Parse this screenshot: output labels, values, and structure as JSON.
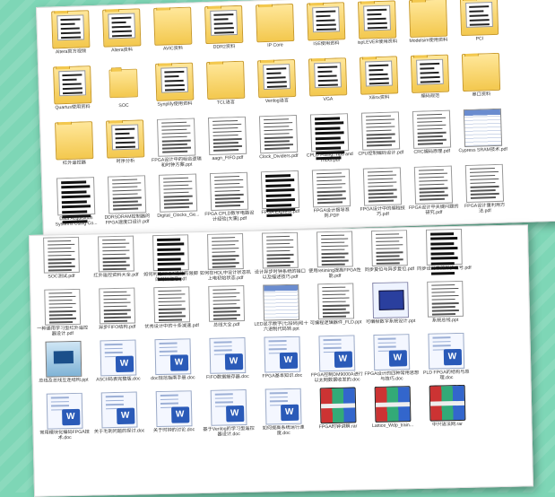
{
  "window1": {
    "items": [
      {
        "label": "Altera官方视频",
        "type": "folder"
      },
      {
        "label": "Altera资料",
        "type": "folder"
      },
      {
        "label": "AVIC资料",
        "type": "folder-empty"
      },
      {
        "label": "DDR2资料",
        "type": "folder"
      },
      {
        "label": "IP Core",
        "type": "folder-empty"
      },
      {
        "label": "ISE使用资料",
        "type": "folder"
      },
      {
        "label": "ispLEVER使用资料",
        "type": "folder"
      },
      {
        "label": "Modelsim使用资料",
        "type": "folder-empty"
      },
      {
        "label": "PCI",
        "type": "folder"
      },
      {
        "label": "",
        "type": "none"
      },
      {
        "label": "Quartus使用资料",
        "type": "folder"
      },
      {
        "label": "SOC",
        "type": "folder-empty-small"
      },
      {
        "label": "Synplify使用资料",
        "type": "folder"
      },
      {
        "label": "TCL语言",
        "type": "folder-empty"
      },
      {
        "label": "Verilog语言",
        "type": "folder"
      },
      {
        "label": "VGA",
        "type": "folder"
      },
      {
        "label": "Xilinx资料",
        "type": "folder"
      },
      {
        "label": "编码规范",
        "type": "folder"
      },
      {
        "label": "串口资料",
        "type": "folder-empty"
      },
      {
        "label": "",
        "type": "none"
      },
      {
        "label": "红外遥控器",
        "type": "folder-empty"
      },
      {
        "label": "时序分析",
        "type": "folder"
      },
      {
        "label": "FPGA设计中的组合逻辑和时钟方案.ppt",
        "type": "doc"
      },
      {
        "label": "aagn_FIFO.pdf",
        "type": "pdf"
      },
      {
        "label": "Clock_Dividers.pdf",
        "type": "pdf"
      },
      {
        "label": "CPLD Fitting, Tips and Tricks.pdf",
        "type": "pdf-dark"
      },
      {
        "label": "CPU控制编码设计.pdf",
        "type": "pdf"
      },
      {
        "label": "CRC编码原理.pdf",
        "type": "pdf"
      },
      {
        "label": "Cypress SRAM技术.pdf",
        "type": "xls"
      },
      {
        "label": "",
        "type": "none"
      },
      {
        "label": "Data Acquisition Systems Using Co...",
        "type": "pdf-dark"
      },
      {
        "label": "DDRSDRAM控制器的FPGA速度口设计.pdf",
        "type": "pdf"
      },
      {
        "label": "Digital_Clocks_Ge...",
        "type": "pdf"
      },
      {
        "label": "FPGA CPLD数字电路设计经验(大蒲).pdf",
        "type": "pdf"
      },
      {
        "label": "FPGA Express.pdf",
        "type": "pdf-dark"
      },
      {
        "label": "FPGA设计指导准则.PDF",
        "type": "pdf"
      },
      {
        "label": "FPGA设计中的编程技巧.pdf",
        "type": "pdf"
      },
      {
        "label": "FPGA设计中关键问题的研究.pdf",
        "type": "pdf"
      },
      {
        "label": "FPGA设计重利用方法.pdf",
        "type": "pdf"
      }
    ]
  },
  "window2": {
    "items": [
      {
        "label": "SOC测试.pdf",
        "type": "pdf"
      },
      {
        "label": "红外遥控资料大全.pdf",
        "type": "pdf"
      },
      {
        "label": "如何利用FPGA设计有限脚的时钟信号.pdf",
        "type": "pdf-dark"
      },
      {
        "label": "如何在HDL中设计状态机上电初始状态.pdf",
        "type": "pdf"
      },
      {
        "label": "设计异步时钟系统的接口以及描述技巧.pdf",
        "type": "pdf"
      },
      {
        "label": "使用retiming提高FPGA性能.pdf",
        "type": "pdf"
      },
      {
        "label": "同步复位与异步复位.pdf",
        "type": "pdf"
      },
      {
        "label": "同步设计中的异步信号.pdf",
        "type": "pdf-dark"
      },
      {
        "label": "",
        "type": "none"
      },
      {
        "label": "一种通用学习型红外遥控器设计.pdf",
        "type": "pdf"
      },
      {
        "label": "异步FIFO结构.pdf",
        "type": "pdf"
      },
      {
        "label": "优秀设计中的十条减速.pdf",
        "type": "pdf"
      },
      {
        "label": "总线大全.pdf",
        "type": "pdf"
      },
      {
        "label": "LED显示数字(七段码)和十六进制代码转.ppt",
        "type": "xls"
      },
      {
        "label": "可编程逻辑器件_FLD.ppt",
        "type": "pdf"
      },
      {
        "label": "可编程数字系统设计.ppt",
        "type": "ppt"
      },
      {
        "label": "系统总线.ppt",
        "type": "pdf"
      },
      {
        "label": "",
        "type": "none"
      },
      {
        "label": "总线及总线互连结构.ppt",
        "type": "img"
      },
      {
        "label": "ASCII码表完整版.doc",
        "type": "word"
      },
      {
        "label": "doc规范指南手册.doc",
        "type": "word"
      },
      {
        "label": "FIFO数据缓存器.doc",
        "type": "word"
      },
      {
        "label": "FPGA基本知识.doc",
        "type": "word"
      },
      {
        "label": "FPGA控制DM9000A进行以太网数据收发的.doc",
        "type": "word"
      },
      {
        "label": "FPGA设计的四种常用思想与技巧.doc",
        "type": "word"
      },
      {
        "label": "PLD FPGA的结构与原理.doc",
        "type": "word"
      },
      {
        "label": "",
        "type": "none"
      },
      {
        "label": "常用模块化编码FPGA技术.doc",
        "type": "word"
      },
      {
        "label": "关于毛刺问题的探讨.doc",
        "type": "word"
      },
      {
        "label": "关于时钟的讨论.doc",
        "type": "word"
      },
      {
        "label": "基于Verilog的学习型遥控器设计.doc",
        "type": "word"
      },
      {
        "label": "如何提高系统运行速度.doc",
        "type": "word"
      },
      {
        "label": "FPGA时钟讲解.rar",
        "type": "rar"
      },
      {
        "label": "Lattice_Wdp_train...",
        "type": "rar"
      },
      {
        "label": "中兴语法网.rar",
        "type": "rar"
      },
      {
        "label": "",
        "type": "none"
      }
    ]
  }
}
